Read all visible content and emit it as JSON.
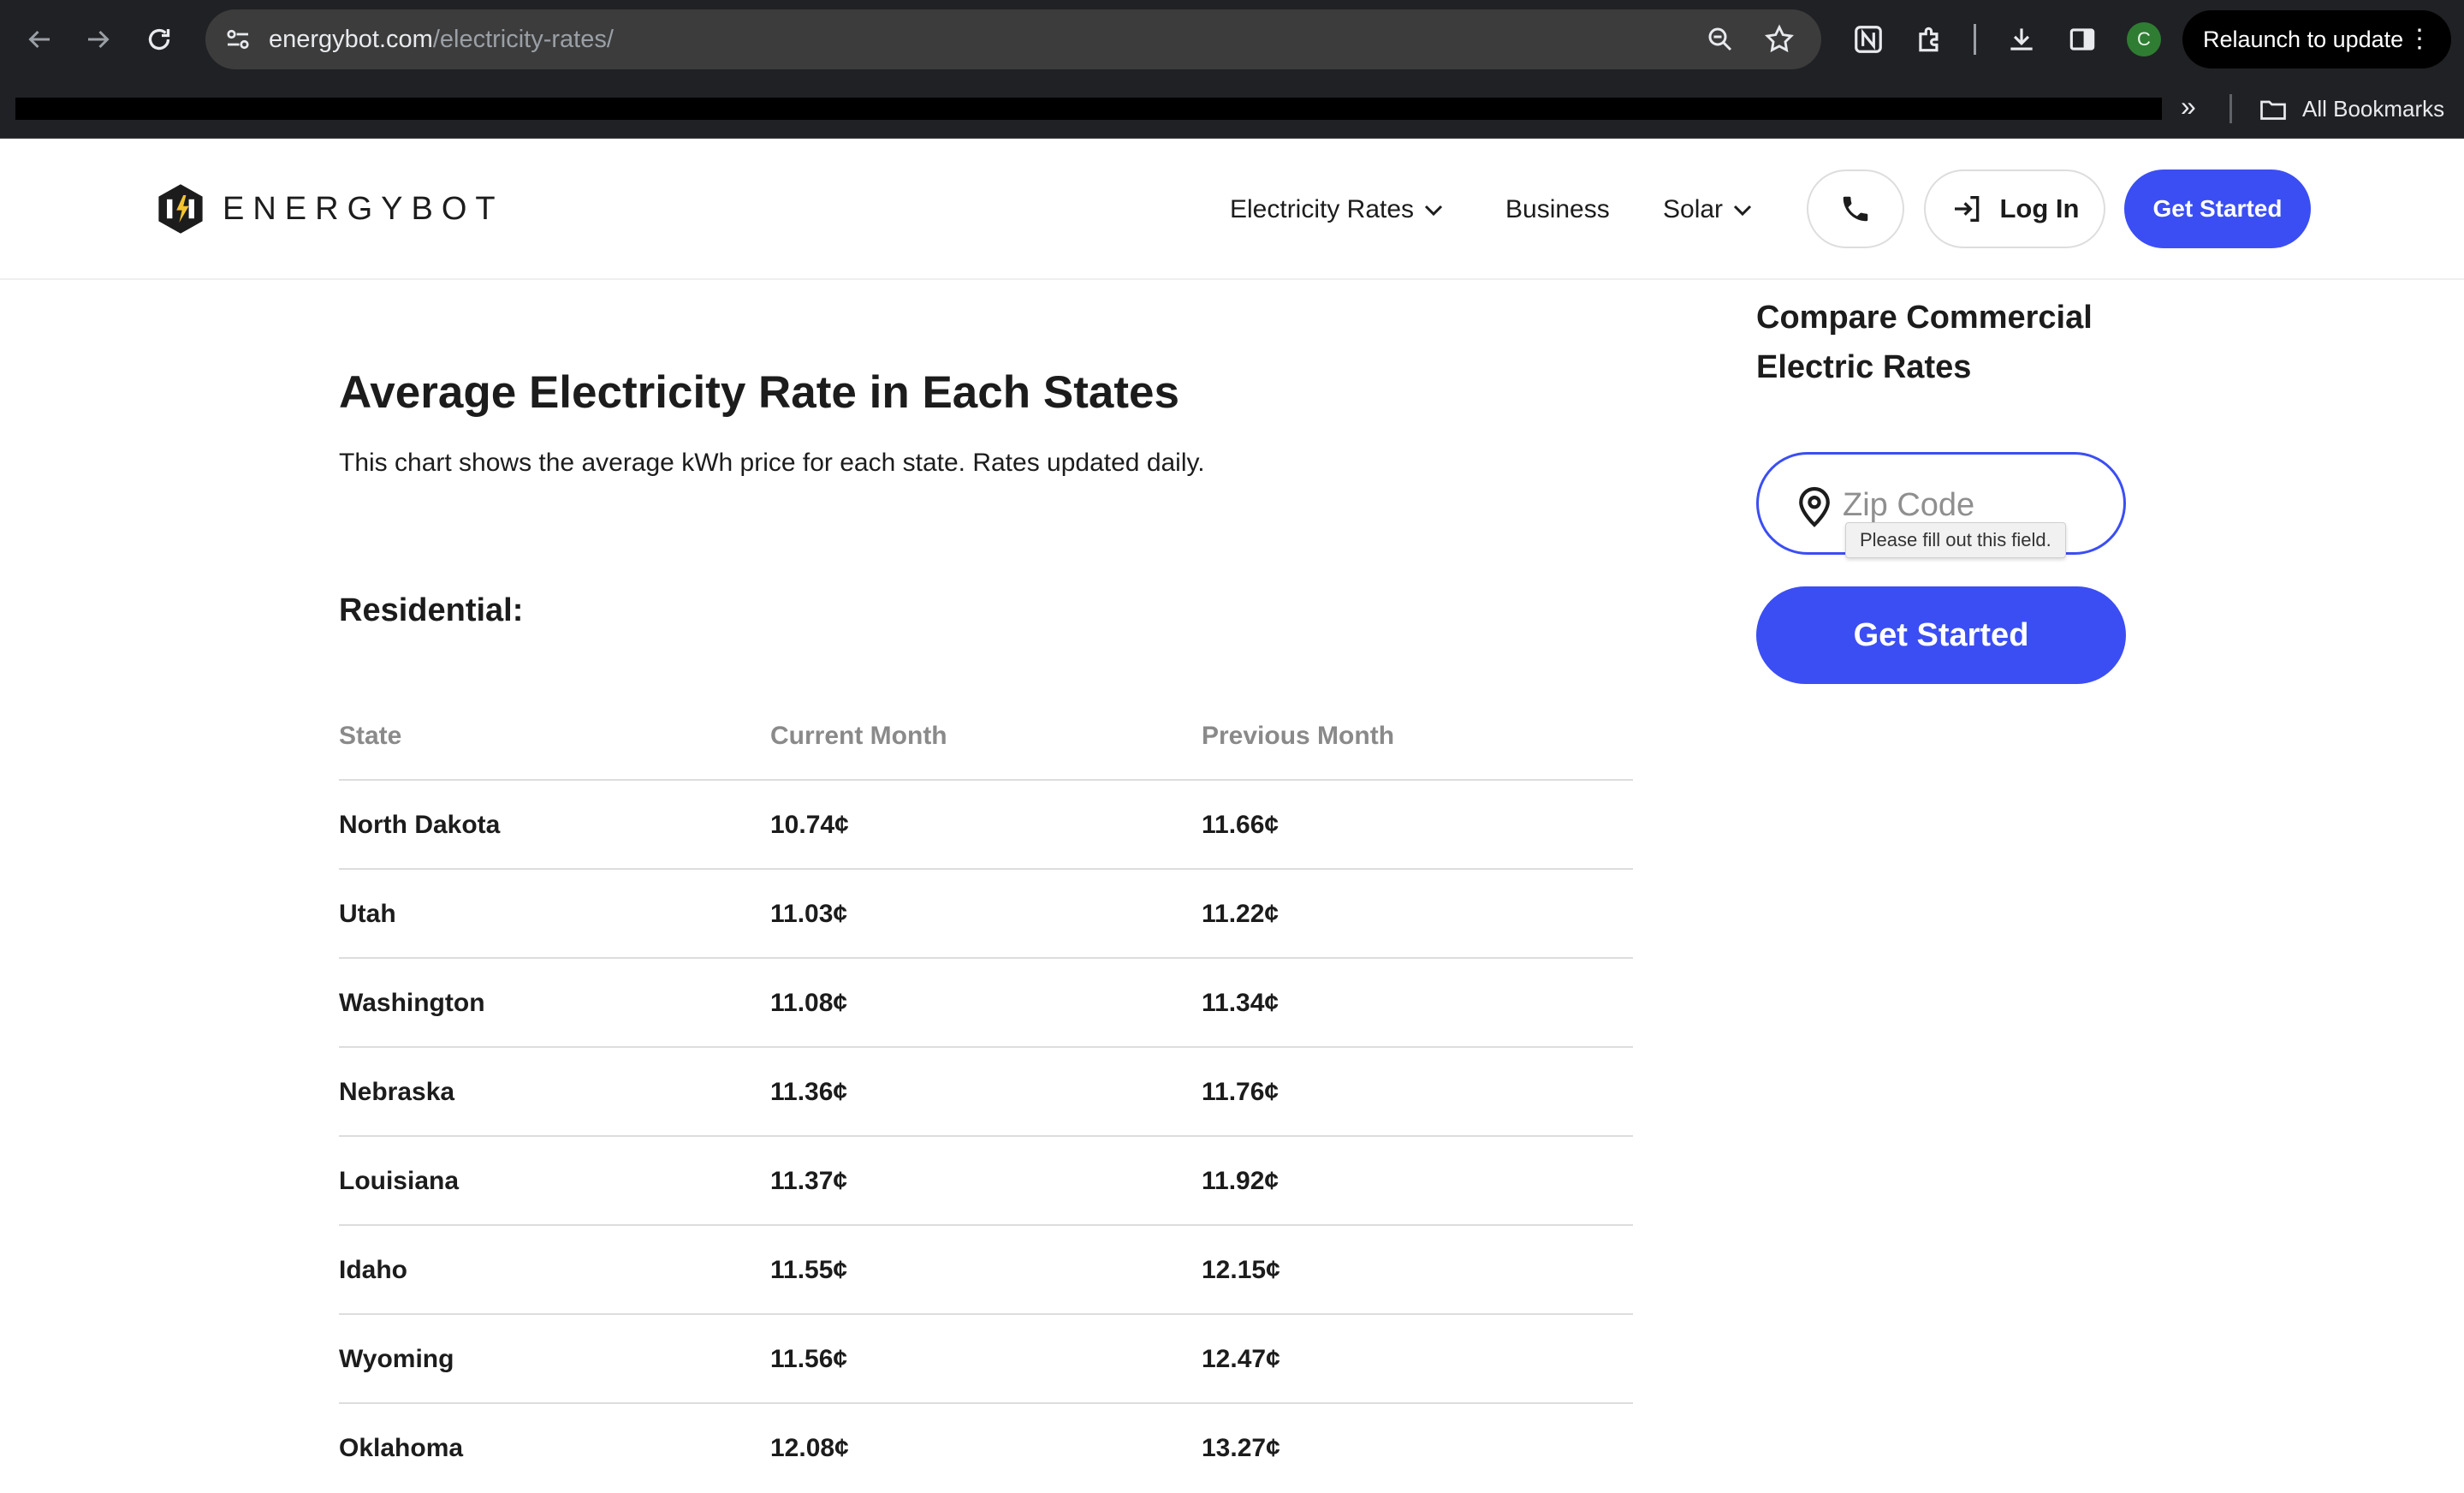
{
  "browser": {
    "url_host": "energybot.com",
    "url_path": "/electricity-rates/",
    "profile_initial": "C",
    "relaunch_label": "Relaunch to update",
    "relaunch_menu": "⋮",
    "bookmarks_more": "»",
    "all_bookmarks_label": "All Bookmarks"
  },
  "header": {
    "logo_text": "ENERGYBOT",
    "nav": {
      "electricity_rates": "Electricity Rates",
      "business": "Business",
      "solar": "Solar"
    },
    "login_label": "Log In",
    "cta_label": "Get Started"
  },
  "main": {
    "title": "Average Electricity Rate in Each States",
    "subtitle": "This chart shows the average kWh price for each state. Rates updated daily.",
    "section_title": "Residential:",
    "table": {
      "headers": [
        "State",
        "Current Month",
        "Previous Month"
      ],
      "rows": [
        [
          "North Dakota",
          "10.74¢",
          "11.66¢"
        ],
        [
          "Utah",
          "11.03¢",
          "11.22¢"
        ],
        [
          "Washington",
          "11.08¢",
          "11.34¢"
        ],
        [
          "Nebraska",
          "11.36¢",
          "11.76¢"
        ],
        [
          "Louisiana",
          "11.37¢",
          "11.92¢"
        ],
        [
          "Idaho",
          "11.55¢",
          "12.15¢"
        ],
        [
          "Wyoming",
          "11.56¢",
          "12.47¢"
        ],
        [
          "Oklahoma",
          "12.08¢",
          "13.27¢"
        ]
      ]
    }
  },
  "sidebar": {
    "title": "Compare Commercial Electric Rates",
    "zip_placeholder": "Zip Code",
    "zip_value": "",
    "validation_tooltip": "Please fill out this field.",
    "cta_label": "Get Started"
  },
  "colors": {
    "brand_blue": "#3b4ef3",
    "chrome_dark": "#202124"
  }
}
